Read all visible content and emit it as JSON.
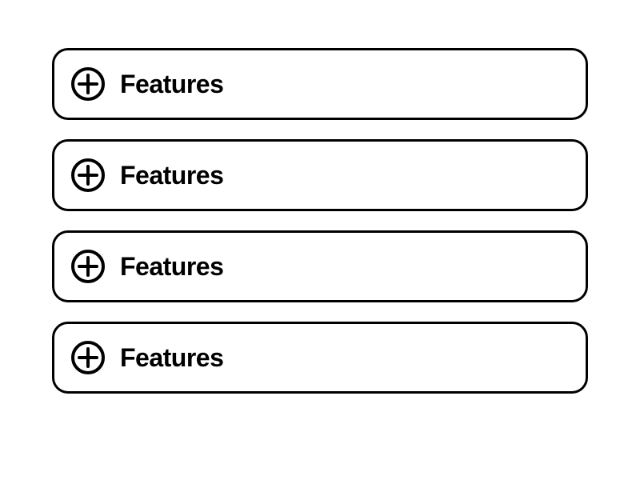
{
  "accordion": {
    "items": [
      {
        "label": "Features"
      },
      {
        "label": "Features"
      },
      {
        "label": "Features"
      },
      {
        "label": "Features"
      }
    ]
  }
}
